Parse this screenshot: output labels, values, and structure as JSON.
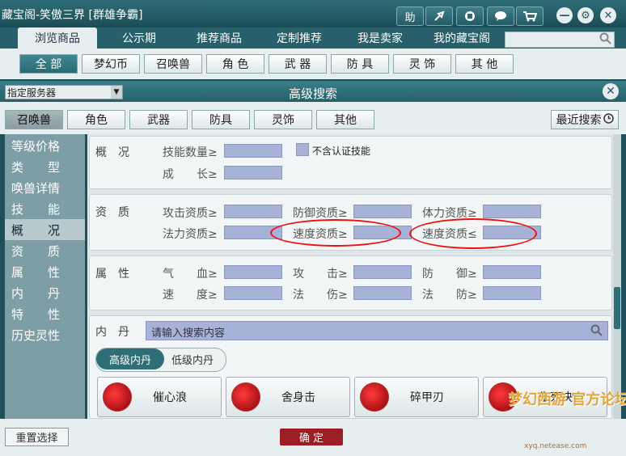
{
  "titlebar": {
    "title": "藏宝阁-笑傲三界 [群雄争霸]",
    "buttons": [
      "助"
    ],
    "icons": [
      "share-icon",
      "stop-icon",
      "chat-icon",
      "cart-icon",
      "minimize-icon",
      "settings-icon",
      "close-icon"
    ]
  },
  "tabs": [
    "浏览商品",
    "公示期",
    "推荐商品",
    "定制推荐",
    "我是卖家",
    "我的藏宝阁"
  ],
  "categories": [
    "全 部",
    "梦幻币",
    "召唤兽",
    "角 色",
    "武 器",
    "防 具",
    "灵 饰",
    "其 他"
  ],
  "advanced": {
    "server_select": "指定服务器",
    "title": "高级搜索"
  },
  "subtabs": [
    "召唤兽",
    "角色",
    "武器",
    "防具",
    "灵饰",
    "其他"
  ],
  "recent_search": "最近搜索",
  "leftnav": [
    "等级价格",
    "类　　型",
    "唤兽详情",
    "技　　能",
    "概　　况",
    "资　　质",
    "属　　性",
    "内　　丹",
    "特　　性",
    "历史灵性"
  ],
  "overview": {
    "section": "概　况",
    "skill_count": "技能数量≥",
    "growth": "成　　长≥",
    "not_certified": "不含认证技能"
  },
  "aptitude": {
    "section": "资　质",
    "attack": "攻击资质≥",
    "defense": "防御资质≥",
    "stamina": "体力资质≥",
    "magic": "法力资质≥",
    "speed_ge": "速度资质≥",
    "speed_le": "速度资质≤"
  },
  "attributes": {
    "section": "属　性",
    "hp": "气　　血≥",
    "attack": "攻　　击≥",
    "defense": "防　　御≥",
    "speed": "速　　度≥",
    "magic_dmg": "法　　伤≥",
    "magic_def": "法　　防≥"
  },
  "neidan": {
    "section": "内　丹",
    "placeholder": "请输入搜索内容",
    "high": "高级内丹",
    "low": "低级内丹",
    "items": [
      "催心浪",
      "舍身击",
      "碎甲刃",
      "生死决"
    ]
  },
  "bottom": {
    "reset": "重置选择",
    "confirm": "确 定"
  },
  "watermark": {
    "text": "梦幻西游 官方论坛",
    "url": "xyq.netease.com"
  }
}
